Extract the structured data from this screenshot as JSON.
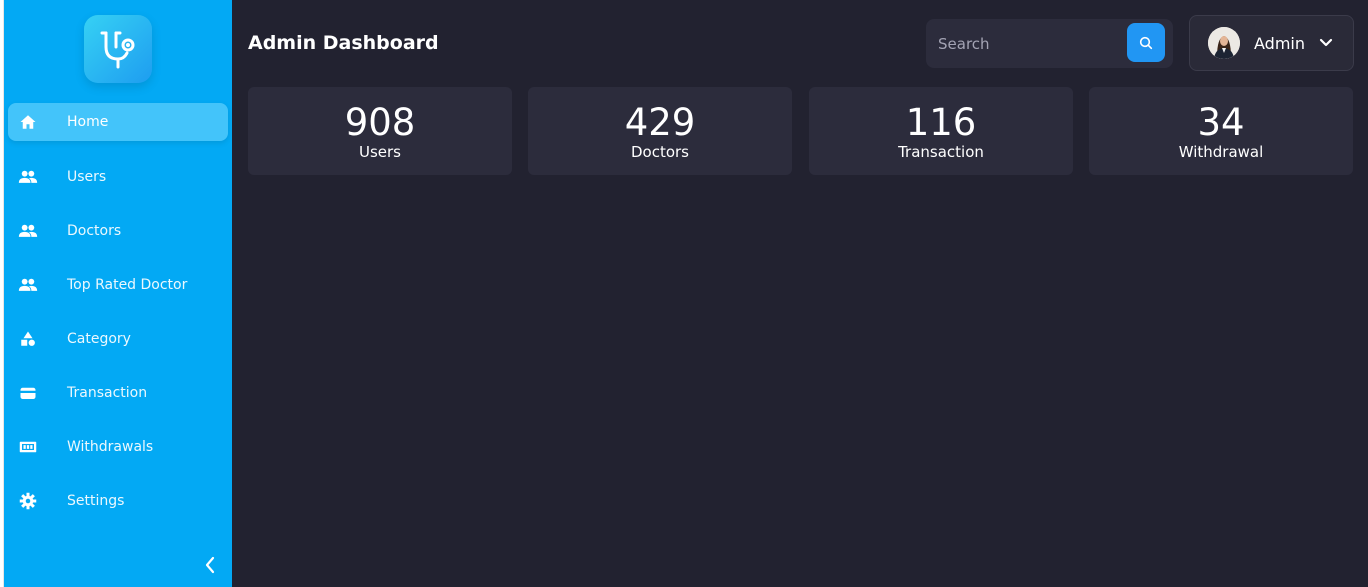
{
  "sidebar": {
    "logo_icon": "stethoscope-icon",
    "items": [
      {
        "label": "Home",
        "icon": "home-icon",
        "active": true
      },
      {
        "label": "Users",
        "icon": "people-icon"
      },
      {
        "label": "Doctors",
        "icon": "people-icon"
      },
      {
        "label": "Top Rated Doctor",
        "icon": "people-icon"
      },
      {
        "label": "Category",
        "icon": "category-icon"
      },
      {
        "label": "Transaction",
        "icon": "card-icon"
      },
      {
        "label": "Withdrawals",
        "icon": "cash-icon"
      },
      {
        "label": "Settings",
        "icon": "gear-icon"
      }
    ],
    "collapse_icon": "chevron-left-icon"
  },
  "header": {
    "title": "Admin Dashboard",
    "search": {
      "placeholder": "Search",
      "value": "",
      "button_icon": "search-icon"
    },
    "profile": {
      "name": "Admin",
      "avatar_icon": "avatar",
      "dropdown_icon": "chevron-down-icon"
    }
  },
  "stats": [
    {
      "value": "908",
      "label": "Users"
    },
    {
      "value": "429",
      "label": "Doctors"
    },
    {
      "value": "116",
      "label": "Transaction"
    },
    {
      "value": "34",
      "label": "Withdrawal"
    }
  ],
  "colors": {
    "sidebar_bg": "#03a9f4",
    "sidebar_active": "#43c4fa",
    "main_bg": "#222230",
    "card_bg": "#2c2c3c",
    "accent": "#2196f3"
  }
}
